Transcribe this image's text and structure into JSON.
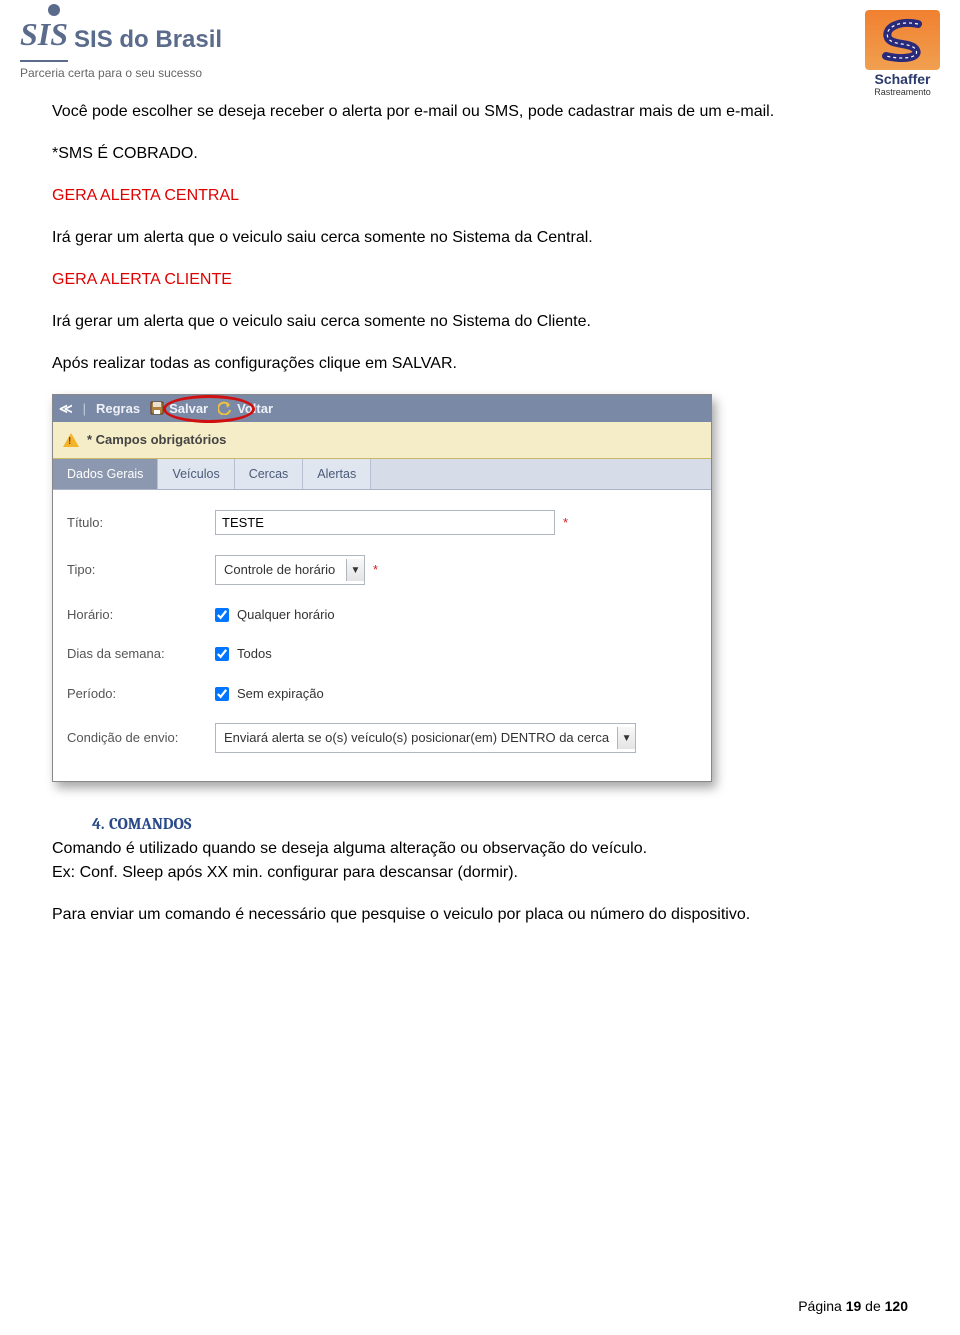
{
  "logos": {
    "left_title": "SIS do Brasil",
    "left_tagline": "Parceria certa para o seu sucesso",
    "right_name": "Schaffer",
    "right_sub": "Rastreamento"
  },
  "body": {
    "p1": "Você pode escolher se deseja receber o alerta por e-mail ou SMS, pode cadastrar mais de um e-mail.",
    "p2": "*SMS É COBRADO.",
    "h_central": "GERA ALERTA CENTRAL",
    "p3": "Irá gerar um alerta que o veiculo saiu cerca somente no Sistema da Central.",
    "h_cliente": "GERA ALERTA CLIENTE",
    "p4": "Irá gerar um alerta que o veiculo saiu cerca somente no Sistema do Cliente.",
    "p5": "Após realizar todas as configurações clique em SALVAR."
  },
  "ui": {
    "toolbar": {
      "chev": "≪",
      "regras": "Regras",
      "salvar": "Salvar",
      "voltar": "Voltar"
    },
    "warn": "* Campos obrigatórios",
    "tabs": [
      "Dados Gerais",
      "Veículos",
      "Cercas",
      "Alertas"
    ],
    "form": {
      "titulo_label": "Título:",
      "titulo_value": "TESTE",
      "tipo_label": "Tipo:",
      "tipo_value": "Controle de horário",
      "horario_label": "Horário:",
      "horario_check": "Qualquer horário",
      "dias_label": "Dias da semana:",
      "dias_check": "Todos",
      "periodo_label": "Período:",
      "periodo_check": "Sem expiração",
      "cond_label": "Condição de envio:",
      "cond_value": "Enviará alerta se o(s) veículo(s) posicionar(em) DENTRO da cerca"
    }
  },
  "section4": {
    "num": "4.",
    "title": "COMANDOS",
    "p1": "Comando é utilizado quando se deseja alguma alteração ou observação do veículo.",
    "p2": "Ex: Conf. Sleep após XX min. configurar para descansar (dormir).",
    "p3": "Para enviar um comando é necessário que pesquise o veiculo por placa ou número do dispositivo."
  },
  "footer": {
    "prefix": "Página ",
    "page": "19",
    "mid": " de ",
    "total": "120"
  }
}
